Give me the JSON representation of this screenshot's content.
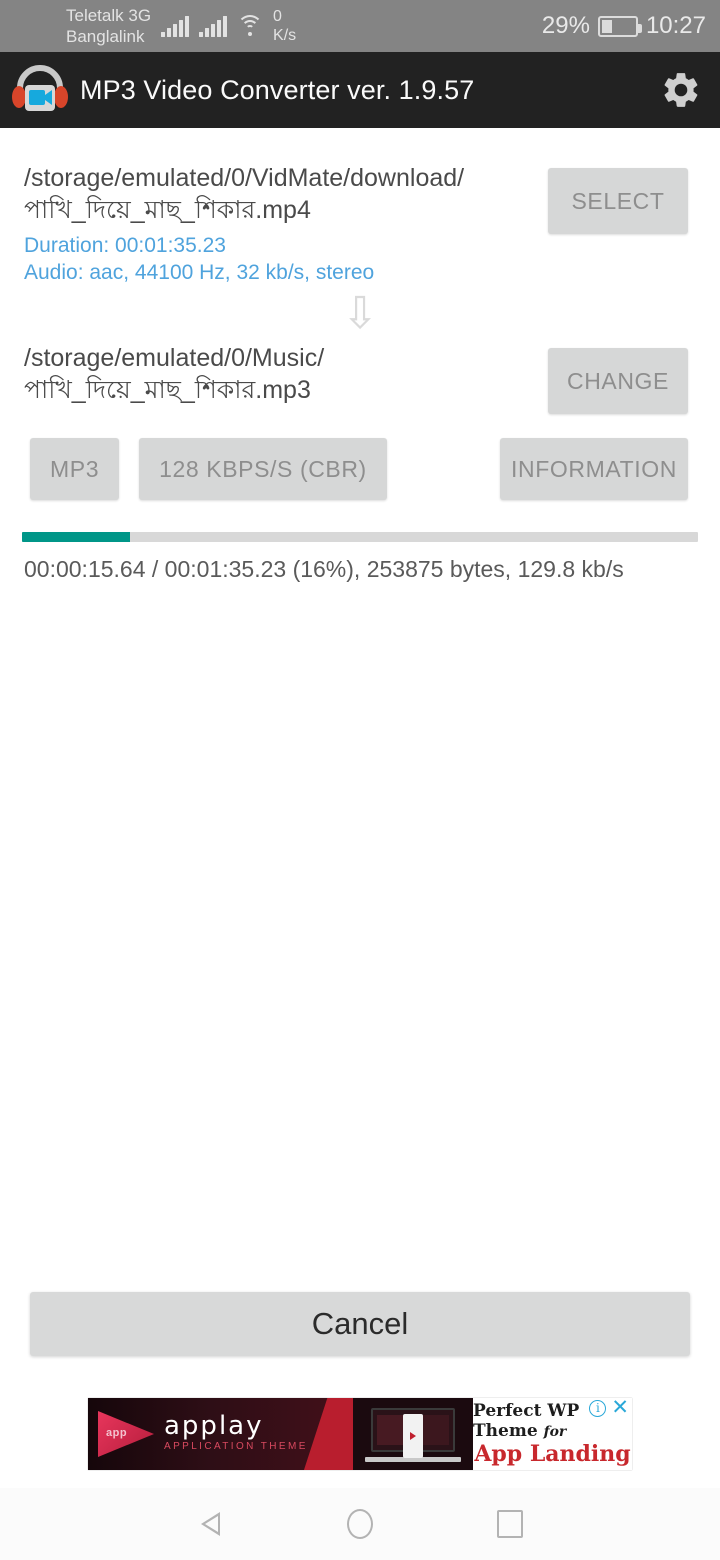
{
  "status_bar": {
    "carrier_line1": "Teletalk 3G",
    "carrier_line2": "Banglalink",
    "data_rate_value": "0",
    "data_rate_unit": "K/s",
    "battery_percent": "29%",
    "battery_level": 29,
    "time": "10:27"
  },
  "app_bar": {
    "title": "MP3 Video Converter ver. 1.9.57",
    "icon": "headphones-video-icon",
    "settings_icon": "gear-icon",
    "background": "#222222"
  },
  "input_file": {
    "path": "/storage/emulated/0/VidMate/download/",
    "filename": "পাখি_দিয়ে_মাছ_শিকার.mp4",
    "duration": "Duration: 00:01:35.23",
    "audio": "Audio: aac, 44100 Hz, 32 kb/s, stereo",
    "info_color": "#4fa3dd",
    "select_label": "SELECT"
  },
  "arrow_icon": "⇩",
  "output_file": {
    "path": "/storage/emulated/0/Music/",
    "filename": "পাখি_দিয়ে_মাছ_শিকার.mp3",
    "change_label": "CHANGE"
  },
  "options": {
    "format_label": "MP3",
    "bitrate_label": "128 KBPS/S (CBR)",
    "information_label": "INFORMATION"
  },
  "progress": {
    "percent": 16,
    "fill_color": "#009688",
    "track_color": "#d8d8d8",
    "status_text": "00:00:15.64 / 00:01:35.23 (16%), 253875 bytes, 129.8 kb/s"
  },
  "cancel_label": "Cancel",
  "ad": {
    "logo_badge": "app",
    "brand": "applay",
    "brand_sub": "APPLICATION THEME",
    "headline": "Perfect WP Theme",
    "headline_italic": "for",
    "subhead": "App Landing",
    "info_icon": "i",
    "close_icon": "✕",
    "accent_color": "#c8282d",
    "icon_color": "#2aa8d8"
  },
  "nav_bar": {
    "back": "back-icon",
    "home": "home-icon",
    "recents": "recents-icon"
  }
}
